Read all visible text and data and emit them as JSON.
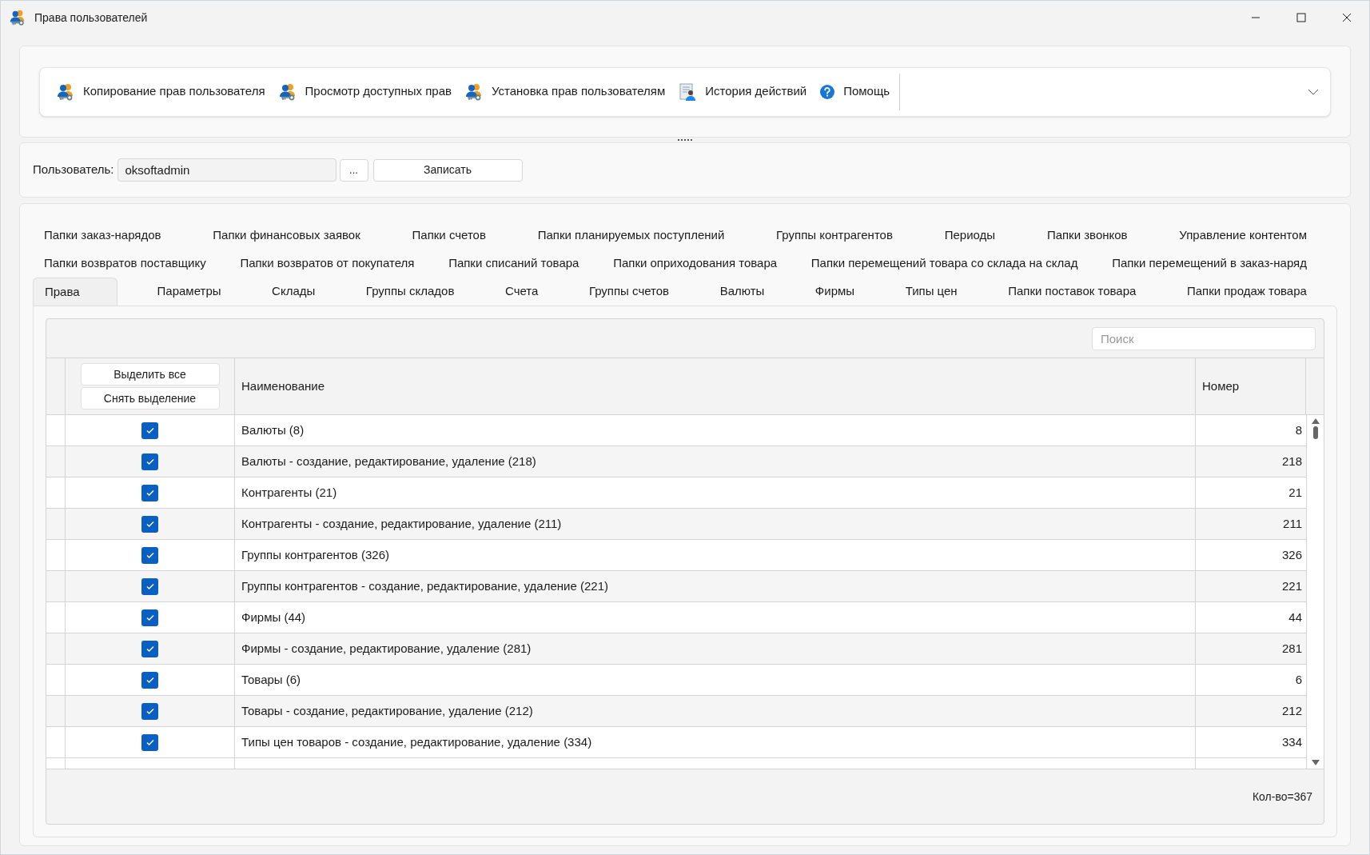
{
  "window": {
    "title": "Права пользователей"
  },
  "toolbar": [
    {
      "label": "Копирование прав пользователя",
      "kind": "user-key"
    },
    {
      "label": "Просмотр доступных прав",
      "kind": "user-key"
    },
    {
      "label": "Установка прав пользователям",
      "kind": "user-key"
    },
    {
      "label": "История действий",
      "kind": "history"
    },
    {
      "label": "Помощь",
      "kind": "help"
    }
  ],
  "user": {
    "label": "Пользователь:",
    "value": "oksoftadmin",
    "browse": "...",
    "save": "Записать"
  },
  "tab_rows": [
    [
      {
        "label": "Папки заказ-нарядов",
        "selected": false
      },
      {
        "label": "Папки финансовых заявок",
        "selected": false
      },
      {
        "label": "Папки счетов",
        "selected": false
      },
      {
        "label": "Папки планируемых поступлений",
        "selected": false
      },
      {
        "label": "Группы контрагентов",
        "selected": false
      },
      {
        "label": "Периоды",
        "selected": false
      },
      {
        "label": "Папки звонков",
        "selected": false
      },
      {
        "label": "Управление контентом",
        "selected": false
      }
    ],
    [
      {
        "label": "Папки возвратов поставщику",
        "selected": false
      },
      {
        "label": "Папки возвратов от покупателя",
        "selected": false
      },
      {
        "label": "Папки списаний товара",
        "selected": false
      },
      {
        "label": "Папки оприходования товара",
        "selected": false
      },
      {
        "label": "Папки перемещений товара со склада на склад",
        "selected": false
      },
      {
        "label": "Папки перемещений в заказ-наряд",
        "selected": false
      }
    ],
    [
      {
        "label": "Права",
        "selected": true
      },
      {
        "label": "Параметры",
        "selected": false
      },
      {
        "label": "Склады",
        "selected": false
      },
      {
        "label": "Группы складов",
        "selected": false
      },
      {
        "label": "Счета",
        "selected": false
      },
      {
        "label": "Группы счетов",
        "selected": false
      },
      {
        "label": "Валюты",
        "selected": false
      },
      {
        "label": "Фирмы",
        "selected": false
      },
      {
        "label": "Типы цен",
        "selected": false
      },
      {
        "label": "Папки поставок товара",
        "selected": false
      },
      {
        "label": "Папки продаж товара",
        "selected": false
      }
    ]
  ],
  "grid": {
    "search_placeholder": "Поиск",
    "select_all": "Выделить все",
    "deselect": "Снять выделение",
    "columns": [
      "Наименование",
      "Номер"
    ],
    "rows": [
      {
        "checked": true,
        "name": "Валюты (8)",
        "number": "8"
      },
      {
        "checked": true,
        "name": "Валюты - создание, редактирование, удаление (218)",
        "number": "218"
      },
      {
        "checked": true,
        "name": "Контрагенты (21)",
        "number": "21"
      },
      {
        "checked": true,
        "name": "Контрагенты - создание, редактирование, удаление (211)",
        "number": "211"
      },
      {
        "checked": true,
        "name": "Группы контрагентов (326)",
        "number": "326"
      },
      {
        "checked": true,
        "name": "Группы контрагентов - создание, редактирование, удаление (221)",
        "number": "221"
      },
      {
        "checked": true,
        "name": "Фирмы (44)",
        "number": "44"
      },
      {
        "checked": true,
        "name": "Фирмы - создание, редактирование, удаление (281)",
        "number": "281"
      },
      {
        "checked": true,
        "name": "Товары (6)",
        "number": "6"
      },
      {
        "checked": true,
        "name": "Товары - создание, редактирование, удаление (212)",
        "number": "212"
      },
      {
        "checked": true,
        "name": "Типы цен товаров - создание, редактирование, удаление (334)",
        "number": "334"
      }
    ],
    "count": "Кол-во=367"
  }
}
